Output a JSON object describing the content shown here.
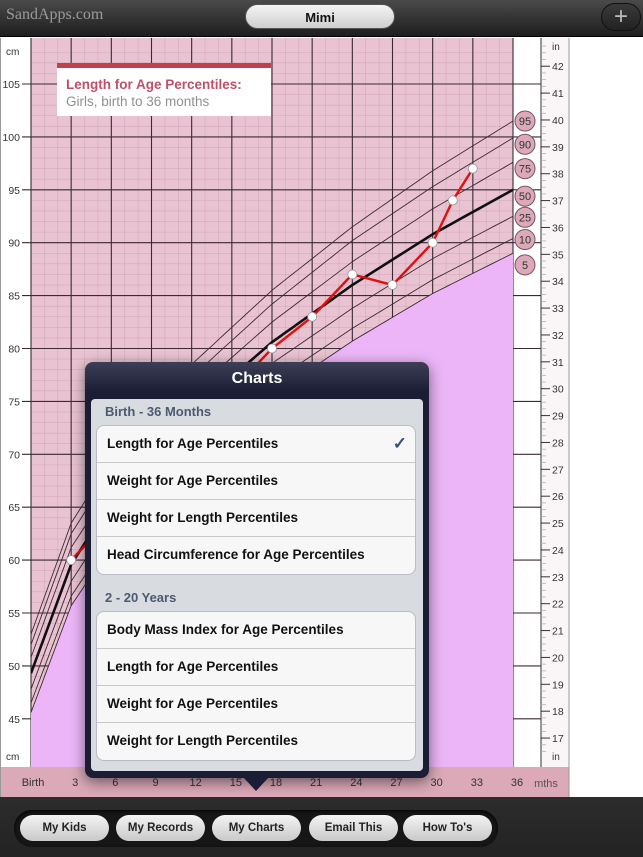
{
  "header": {
    "brand": "SandApps.com",
    "child_name": "Mimi",
    "add_icon": "plus-icon",
    "add_glyph": "+"
  },
  "chart_data": {
    "type": "line",
    "title": "Length for Age Percentiles:",
    "subtitle": "Girls, birth to 36 months",
    "xlabel": "mths",
    "ylabel_left": "cm",
    "ylabel_right": "in",
    "xlim": [
      0,
      36
    ],
    "ylim_cm": [
      43,
      108
    ],
    "x_ticks": [
      0,
      3,
      6,
      9,
      12,
      15,
      18,
      21,
      24,
      27,
      30,
      33,
      36
    ],
    "x_tick_labels": [
      "Birth",
      "3",
      "6",
      "9",
      "12",
      "15",
      "18",
      "21",
      "24",
      "27",
      "30",
      "33",
      "36"
    ],
    "y_ticks_cm": [
      45,
      50,
      55,
      60,
      65,
      70,
      75,
      80,
      85,
      90,
      95,
      100,
      105
    ],
    "y_ticks_in": [
      17,
      18,
      19,
      20,
      21,
      22,
      23,
      24,
      25,
      26,
      27,
      28,
      29,
      30,
      31,
      32,
      33,
      34,
      35,
      36,
      37,
      38,
      39,
      40,
      41,
      42
    ],
    "grid": true,
    "percentile_labels": [
      "95",
      "90",
      "75",
      "50",
      "25",
      "10",
      "5"
    ],
    "percentile_curves": [
      {
        "name": "95",
        "x": [
          0,
          3,
          6,
          9,
          12,
          18,
          24,
          30,
          36
        ],
        "values": [
          53.0,
          63.5,
          69.5,
          74.5,
          78.5,
          85.5,
          91.5,
          96.8,
          101.5
        ]
      },
      {
        "name": "90",
        "x": [
          0,
          3,
          6,
          9,
          12,
          18,
          24,
          30,
          36
        ],
        "values": [
          52.0,
          62.5,
          68.5,
          73.3,
          77.3,
          84.2,
          90.2,
          95.3,
          99.9
        ]
      },
      {
        "name": "75",
        "x": [
          0,
          3,
          6,
          9,
          12,
          18,
          24,
          30,
          36
        ],
        "values": [
          50.8,
          61.2,
          67.0,
          71.8,
          75.8,
          82.5,
          88.2,
          93.2,
          97.6
        ]
      },
      {
        "name": "50",
        "x": [
          0,
          3,
          6,
          9,
          12,
          18,
          24,
          30,
          36
        ],
        "values": [
          49.3,
          59.6,
          65.5,
          70.2,
          74.0,
          80.6,
          86.0,
          90.8,
          95.0
        ]
      },
      {
        "name": "25",
        "x": [
          0,
          3,
          6,
          9,
          12,
          18,
          24,
          30,
          36
        ],
        "values": [
          47.8,
          58.0,
          63.8,
          68.5,
          72.2,
          78.6,
          83.8,
          88.5,
          92.5
        ]
      },
      {
        "name": "10",
        "x": [
          0,
          3,
          6,
          9,
          12,
          18,
          24,
          30,
          36
        ],
        "values": [
          46.5,
          56.6,
          62.3,
          67.0,
          70.6,
          76.8,
          81.9,
          86.5,
          90.4
        ]
      },
      {
        "name": "5",
        "x": [
          0,
          3,
          6,
          9,
          12,
          18,
          24,
          30,
          36
        ],
        "values": [
          45.6,
          55.7,
          61.3,
          65.9,
          69.5,
          75.6,
          80.7,
          85.2,
          89.0
        ]
      }
    ],
    "series": [
      {
        "name": "Mimi",
        "color": "#e01010",
        "x": [
          3,
          18,
          21,
          24,
          27,
          30,
          31.5,
          33
        ],
        "values": [
          60,
          80,
          83,
          87,
          86,
          90,
          94,
          97
        ]
      }
    ]
  },
  "colors": {
    "chart_bg": "#e9c3d1",
    "low_region": "#ebb5f7",
    "grid_major": "#3a2a33",
    "measure_line": "#e01010",
    "median_line": "#111111",
    "title_accent": "#c0404f"
  },
  "popover": {
    "title": "Charts",
    "sections": [
      {
        "header": "Birth - 36 Months",
        "items": [
          {
            "label": "Length for Age Percentiles",
            "checked": true
          },
          {
            "label": "Weight for Age Percentiles",
            "checked": false
          },
          {
            "label": "Weight for Length Percentiles",
            "checked": false
          },
          {
            "label": "Head Circumference for Age Percentiles",
            "checked": false
          }
        ]
      },
      {
        "header": "2 - 20 Years",
        "items": [
          {
            "label": "Body Mass Index for Age Percentiles",
            "checked": false
          },
          {
            "label": "Length for Age Percentiles",
            "checked": false
          },
          {
            "label": "Weight for Age Percentiles",
            "checked": false
          },
          {
            "label": "Weight for Length Percentiles",
            "checked": false
          }
        ]
      }
    ],
    "check_glyph": "✓"
  },
  "toolbar": {
    "buttons": [
      "My Kids",
      "My Records",
      "My Charts",
      "Email This",
      "How To's"
    ]
  }
}
